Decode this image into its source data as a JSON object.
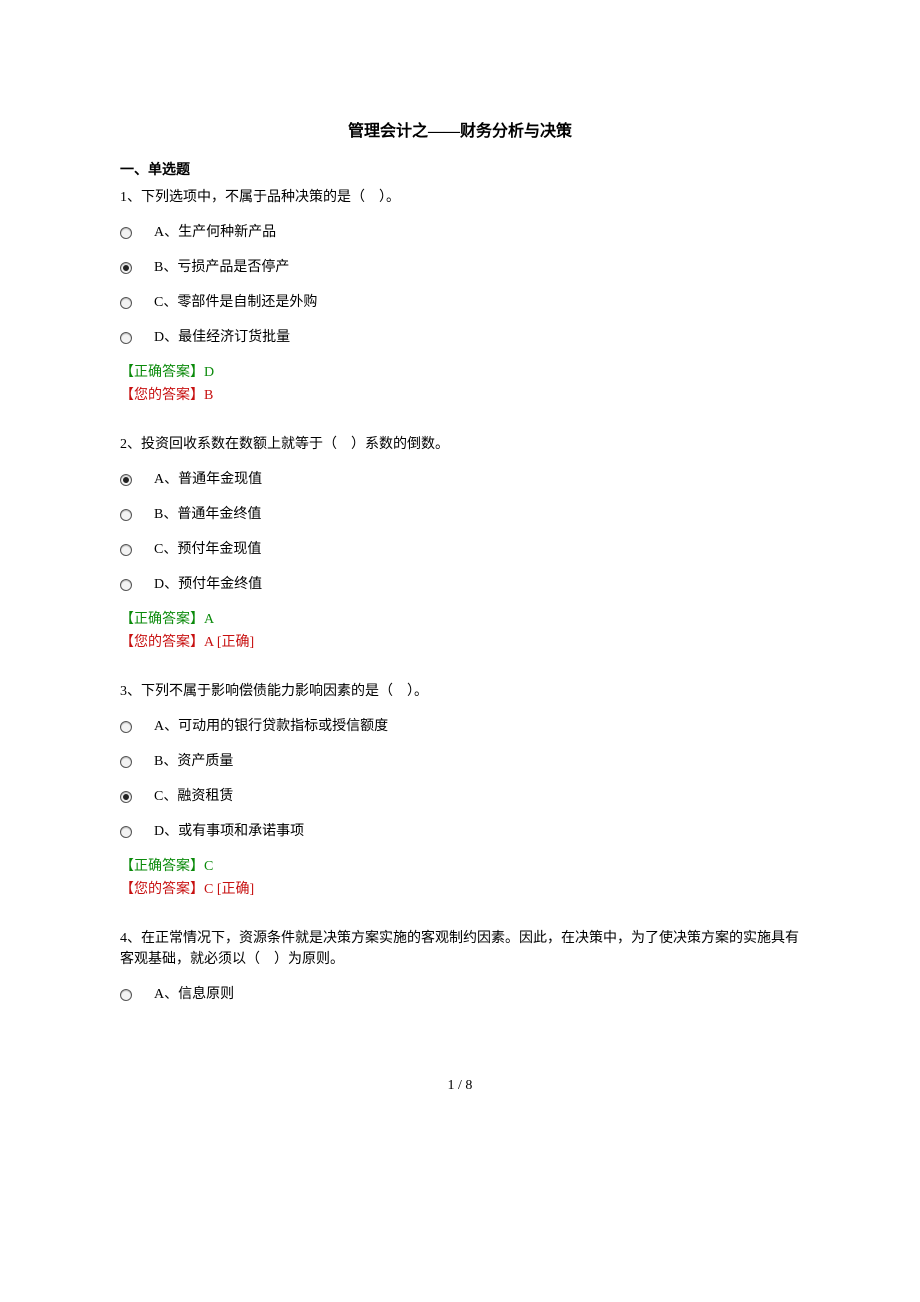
{
  "title": "管理会计之——财务分析与决策",
  "section_header": "一、单选题",
  "questions": [
    {
      "text": "1、下列选项中，不属于品种决策的是（　）。",
      "options": [
        {
          "label": "A、生产何种新产品",
          "selected": false
        },
        {
          "label": "B、亏损产品是否停产",
          "selected": true
        },
        {
          "label": "C、零部件是自制还是外购",
          "selected": false
        },
        {
          "label": "D、最佳经济订货批量",
          "selected": false
        }
      ],
      "correct": "【正确答案】D",
      "yours": "【您的答案】B",
      "mark": ""
    },
    {
      "text": "2、投资回收系数在数额上就等于（　）系数的倒数。",
      "options": [
        {
          "label": "A、普通年金现值",
          "selected": true
        },
        {
          "label": "B、普通年金终值",
          "selected": false
        },
        {
          "label": "C、预付年金现值",
          "selected": false
        },
        {
          "label": "D、预付年金终值",
          "selected": false
        }
      ],
      "correct": "【正确答案】A",
      "yours": "【您的答案】A",
      "mark": "   [正确]"
    },
    {
      "text": "3、下列不属于影响偿债能力影响因素的是（　）。",
      "options": [
        {
          "label": "A、可动用的银行贷款指标或授信额度",
          "selected": false
        },
        {
          "label": "B、资产质量",
          "selected": false
        },
        {
          "label": "C、融资租赁",
          "selected": true
        },
        {
          "label": "D、或有事项和承诺事项",
          "selected": false
        }
      ],
      "correct": "【正确答案】C",
      "yours": "【您的答案】C",
      "mark": "   [正确]"
    },
    {
      "text": "4、在正常情况下，资源条件就是决策方案实施的客观制约因素。因此，在决策中，为了使决策方案的实施具有客观基础，就必须以（　）为原则。",
      "options": [
        {
          "label": "A、信息原则",
          "selected": false
        }
      ],
      "correct": "",
      "yours": "",
      "mark": ""
    }
  ],
  "page_num": "1 / 8"
}
